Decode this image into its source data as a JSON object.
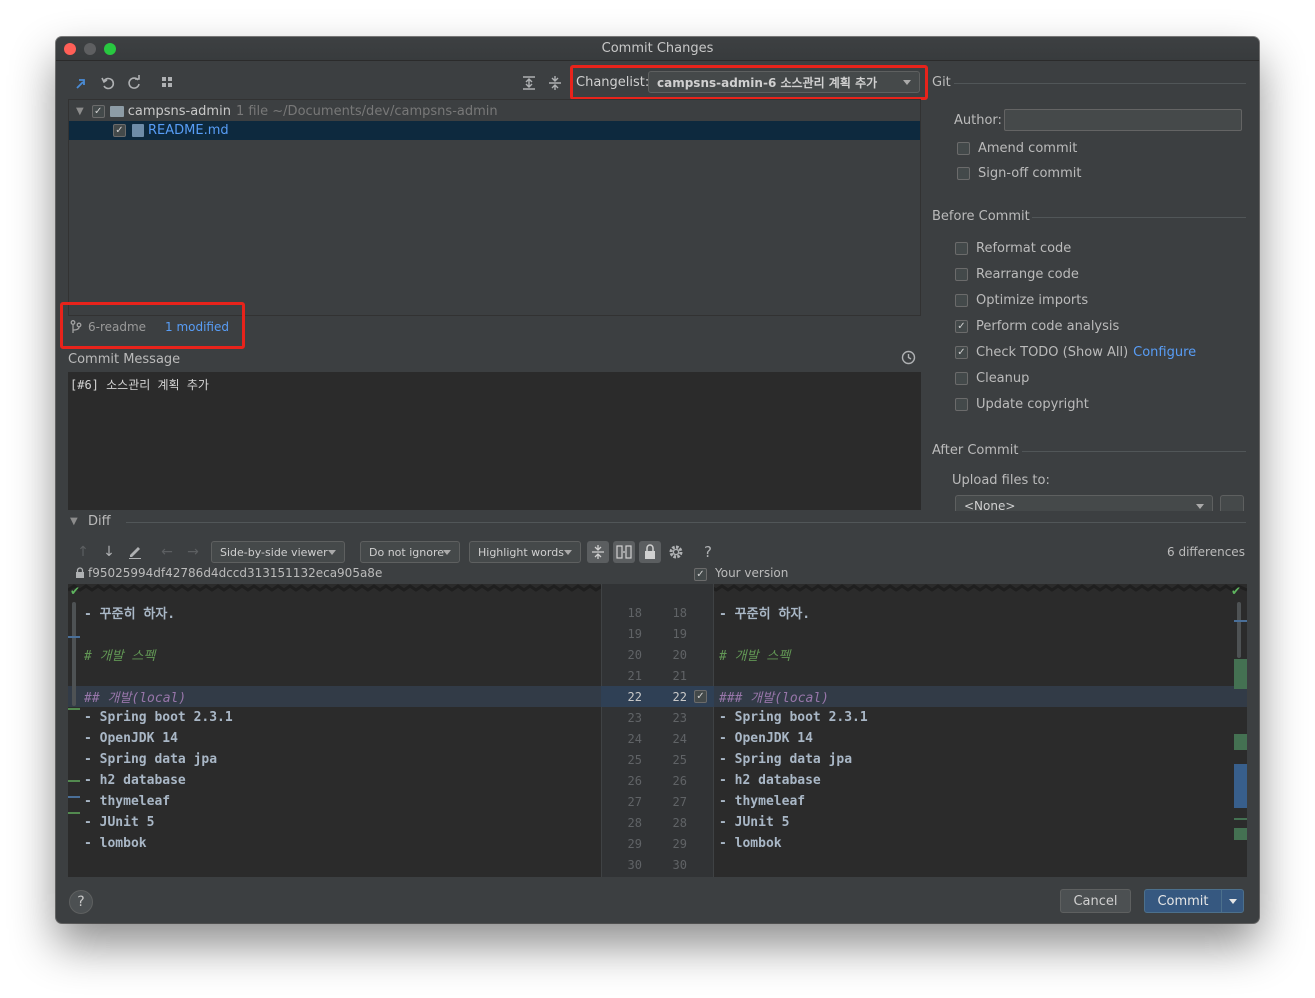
{
  "window": {
    "title": "Commit Changes"
  },
  "toolbar": {
    "icons": [
      "move-changes-icon",
      "rollback-icon",
      "refresh-icon",
      "group-by-icon",
      "expand-all-icon",
      "collapse-all-icon"
    ],
    "changelist_label": "Changelist:",
    "changelist_value": "campsns-admin-6 소스관리 계획 추가"
  },
  "vcs": {
    "label": "Git"
  },
  "tree": {
    "root": {
      "name": "campsns-admin",
      "meta": "1 file ~/Documents/dev/campsns-admin"
    },
    "file": {
      "name": "README.md"
    }
  },
  "status": {
    "branch": "6-readme",
    "modified": "1 modified"
  },
  "commit_message": {
    "label": "Commit Message",
    "text": "[#6] 소스관리 계획 추가"
  },
  "git_options": {
    "author_label": "Author:",
    "author_value": "",
    "amend": "Amend commit",
    "signoff": "Sign-off commit"
  },
  "before_commit": {
    "title": "Before Commit",
    "options": [
      {
        "label": "Reformat code",
        "checked": false
      },
      {
        "label": "Rearrange code",
        "checked": false
      },
      {
        "label": "Optimize imports",
        "checked": false
      },
      {
        "label": "Perform code analysis",
        "checked": true
      },
      {
        "label": "Check TODO (Show All)",
        "checked": true,
        "link": "Configure"
      },
      {
        "label": "Cleanup",
        "checked": false
      },
      {
        "label": "Update copyright",
        "checked": false
      }
    ]
  },
  "after_commit": {
    "title": "After Commit",
    "upload_label": "Upload files to:",
    "upload_value": "<None>"
  },
  "diff": {
    "title": "Diff",
    "viewer": "Side-by-side viewer",
    "ignore": "Do not ignore",
    "highlight": "Highlight words",
    "help": "?",
    "differences": "6 differences",
    "left_hash": "f95025994df42786d4dccd313151132eca905a8e",
    "right_label": "Your version",
    "left_lines": [
      "- 꾸준히 하자.",
      "",
      "# 개발 스펙",
      "",
      "## 개발(local)",
      "- Spring boot 2.3.1",
      "- OpenJDK 14",
      "- Spring data jpa",
      "- h2 database",
      "- thymeleaf",
      "- JUnit 5",
      "- lombok"
    ],
    "right_lines": [
      "- 꾸준히 하자.",
      "",
      "# 개발 스펙",
      "",
      "### 개발(local)",
      "- Spring boot 2.3.1",
      "- OpenJDK 14",
      "- Spring data jpa",
      "- h2 database",
      "- thymeleaf",
      "- JUnit 5",
      "- lombok"
    ],
    "line_numbers": [
      "18",
      "19",
      "20",
      "21",
      "22",
      "23",
      "24",
      "25",
      "26",
      "27",
      "28",
      "29",
      "30"
    ]
  },
  "footer": {
    "help": "?",
    "cancel": "Cancel",
    "commit": "Commit"
  },
  "colors": {
    "accent": "#365880",
    "link": "#589df6",
    "highlight_box": "#e8231b",
    "selection": "#0d293e"
  }
}
